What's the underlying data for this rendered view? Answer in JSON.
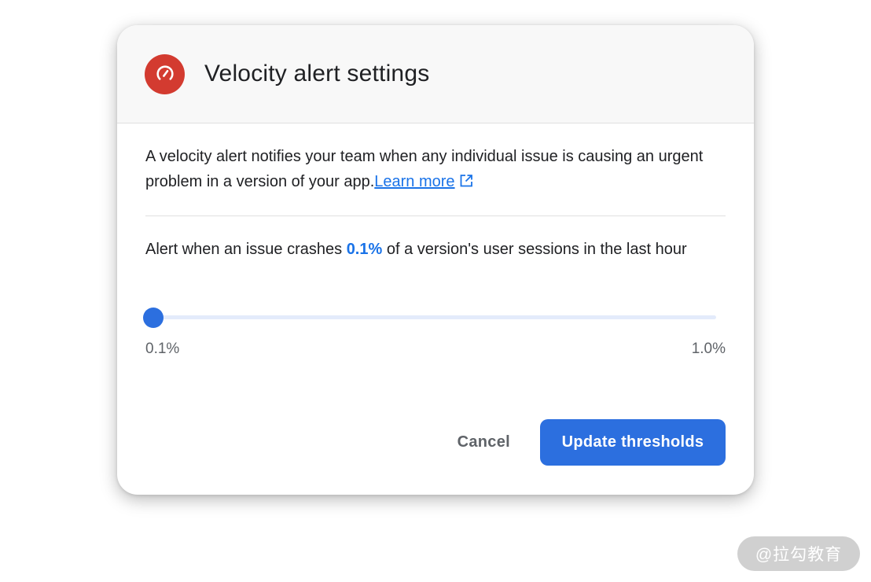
{
  "dialog": {
    "title": "Velocity alert settings",
    "header_icon": "speedometer-icon",
    "description": "A velocity alert notifies your team when any individual issue is causing an urgent problem in a version of your app.",
    "learn_more_label": "Learn more",
    "learn_more_icon": "open-in-new-icon",
    "alert_prefix": "Alert when an issue crashes ",
    "alert_value": "0.1%",
    "alert_suffix": " of a version's user sessions in the last hour",
    "slider": {
      "value": 0.1,
      "min": 0.1,
      "max": 1.0,
      "min_label": "0.1%",
      "max_label": "1.0%"
    },
    "cancel_label": "Cancel",
    "submit_label": "Update thresholds"
  },
  "watermark": "@拉勾教育",
  "colors": {
    "accent": "#2c6fdf",
    "link": "#1a73e8",
    "header_icon_bg": "#d33b30",
    "header_bg": "#f8f8f8",
    "slider_track": "#e3ebfb"
  }
}
